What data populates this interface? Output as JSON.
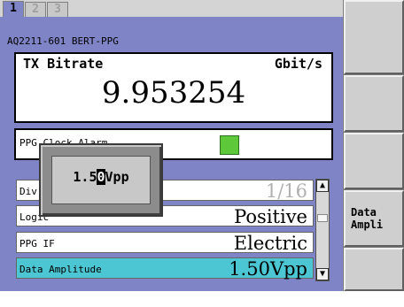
{
  "tabs": [
    {
      "label": "1",
      "active": true
    },
    {
      "label": "2",
      "active": false
    },
    {
      "label": "3",
      "active": false
    }
  ],
  "device_title": "AQ2211-601 BERT-PPG",
  "bitrate": {
    "label": "TX Bitrate",
    "unit": "Gbit/s",
    "value": "9.953254"
  },
  "alarm": {
    "label": "PPG Clock Alarm",
    "led_color": "#5cc83a"
  },
  "rows": [
    {
      "label": "Div",
      "value": "1/16"
    },
    {
      "label": "Logic",
      "value": "Positive"
    },
    {
      "label": "PPG IF",
      "value": "Electric"
    },
    {
      "label": "Data Amplitude",
      "value": "1.50Vpp"
    }
  ],
  "popup": {
    "before_cursor": "1.5",
    "cursor_char": "0",
    "after_cursor": "Vpp"
  },
  "softkeys": [
    {
      "label": ""
    },
    {
      "label": ""
    },
    {
      "label": ""
    },
    {
      "label": "Data\nAmpli"
    },
    {
      "label": ""
    }
  ],
  "colors": {
    "panel": "#7f84c6",
    "selected_row": "#4cc6d2",
    "softkey_bg": "#cfcfcf"
  }
}
